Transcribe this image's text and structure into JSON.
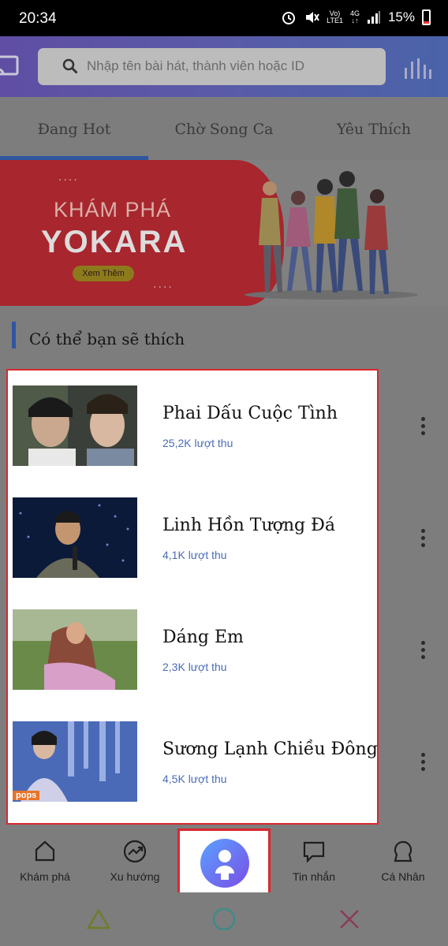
{
  "status_bar": {
    "time": "20:34",
    "network_top": "Vo)",
    "network_bottom": "LTE1",
    "net_type": "4G",
    "battery": "15%"
  },
  "header": {
    "search_placeholder": "Nhập tên bài hát, thành viên hoặc ID"
  },
  "tabs": [
    {
      "label": "Đang Hot",
      "active": true
    },
    {
      "label": "Chờ Song Ca",
      "active": false
    },
    {
      "label": "Yêu Thích",
      "active": false
    }
  ],
  "banner": {
    "line1": "KHÁM PHÁ",
    "line2": "YOKARA",
    "button": "Xem Thêm"
  },
  "section": {
    "title": "Có thể bạn sẽ thích"
  },
  "songs": [
    {
      "title": "Phai Dấu Cuộc Tình",
      "plays": "25,2K lượt thu"
    },
    {
      "title": "Linh Hồn Tượng Đá",
      "plays": "4,1K lượt thu"
    },
    {
      "title": "Dáng Em",
      "plays": "2,3K lượt thu"
    },
    {
      "title": "Sương Lạnh Chiều Đông",
      "plays": "4,5K lượt thu",
      "badge": "pops"
    }
  ],
  "bottom_nav": [
    {
      "label": "Khám phá",
      "icon": "home-icon"
    },
    {
      "label": "Xu hướng",
      "icon": "trending-icon"
    },
    {
      "label": "",
      "icon": "record-icon"
    },
    {
      "label": "Tin nhắn",
      "icon": "message-icon"
    },
    {
      "label": "Cá Nhân",
      "icon": "profile-icon"
    }
  ],
  "colors": {
    "accent": "#2f56a1",
    "highlight_border": "#d9282f",
    "play_count": "#4a6cb6"
  }
}
